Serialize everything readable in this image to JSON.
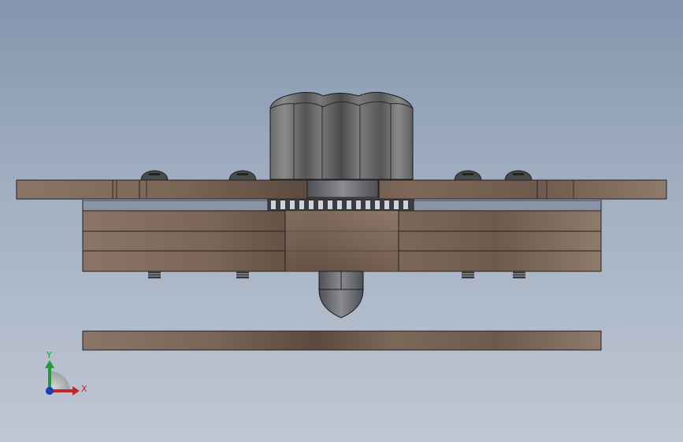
{
  "viewport": {
    "background_top": "#8396ae",
    "background_bottom": "#bfc7d4"
  },
  "model": {
    "wood_color": "#8a7466",
    "wood_dark": "#5e4c40",
    "knob_color": "#5a5a5a",
    "steel_color": "#6d6f74"
  },
  "triad": {
    "x_label": "X",
    "y_label": "Y",
    "x_color": "#c0262c",
    "y_color": "#1f9a3a",
    "z_color": "#2438b8"
  }
}
